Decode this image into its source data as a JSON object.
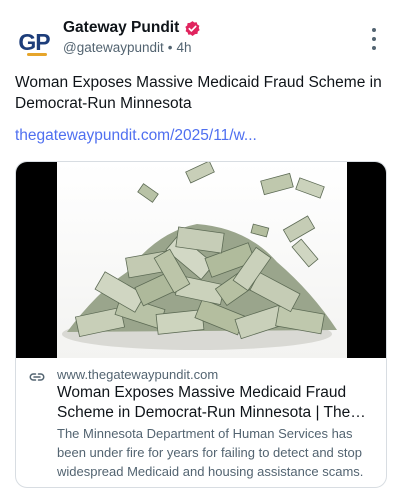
{
  "post": {
    "author": {
      "avatar_text": "GP",
      "display_name": "Gateway Pundit",
      "verified_icon": "verified-badge-icon",
      "handle": "@gatewaypundit",
      "separator": "•",
      "timestamp": "4h"
    },
    "more_icon": "more-vertical-icon",
    "text": "Woman Exposes Massive Medicaid Fraud Scheme in Democrat-Run Minnesota",
    "link_text": "thegatewaypundit.com/2025/11/w...",
    "card": {
      "image_icon": "money-pile-image",
      "link_icon": "link-icon",
      "domain": "www.thegatewaypundit.com",
      "title": "Woman Exposes Massive Medicaid Fraud Scheme in Democrat-Run Minnesota | The Gateway Pundit",
      "description": "The Minnesota Department of Human Services has been under fire for years for failing to detect and stop widespread Medicaid and housing assistance scams."
    }
  },
  "colors": {
    "link": "#4f6ff0",
    "verified": "#e0245e",
    "secondary_text": "#536471",
    "avatar_blue": "#1d3d7a",
    "avatar_gold": "#e6a52b"
  }
}
